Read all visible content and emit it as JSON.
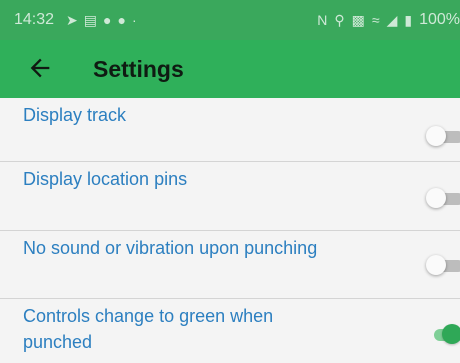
{
  "status_bar": {
    "time": "14:32",
    "left_icons": [
      "navigation-arrow-icon",
      "message-icon",
      "notification-icon",
      "notification-icon",
      "dot-icon"
    ],
    "right_icons": [
      "nfc-icon",
      "location-icon",
      "vibrate-icon",
      "wifi-icon",
      "signal-icon",
      "battery-icon"
    ],
    "battery": "100%",
    "color": "#3aa85c"
  },
  "app_bar": {
    "title": "Settings",
    "back_icon": "back-arrow-icon",
    "color": "#2fb05a"
  },
  "settings": [
    {
      "label": "Display track",
      "enabled": false
    },
    {
      "label": "Display location pins",
      "enabled": false
    },
    {
      "label": "No sound or vibration upon punching",
      "enabled": false
    },
    {
      "label": "Controls change to green when punched",
      "enabled": true
    }
  ],
  "colors": {
    "label_text": "#2c7fc0",
    "switch_on": "#2fa857",
    "switch_off": "#fafafa",
    "background": "#f4f4f4"
  }
}
